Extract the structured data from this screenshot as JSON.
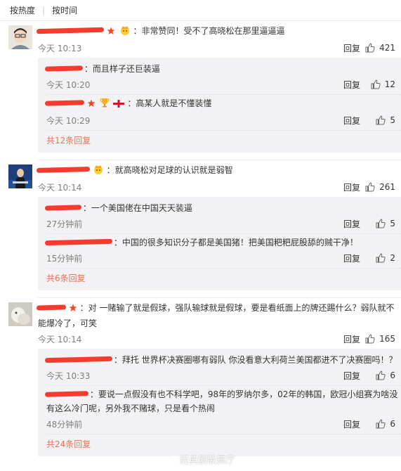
{
  "sort_bar": {
    "hot": "按热度",
    "time": "按时间"
  },
  "comments": [
    {
      "text": "：非常赞同！受不了高晓松在那里逼逼逼",
      "time": "今天 10:13",
      "reply": "回复",
      "likes": "421",
      "subs": [
        {
          "text": "：而且样子还巨装逼",
          "time": "今天 10:20",
          "reply": "回复",
          "likes": "12"
        },
        {
          "text": "：高某人就是不懂装懂",
          "time": "今天 10:29",
          "reply": "回复",
          "likes": "5"
        }
      ],
      "more": "共12条回复"
    },
    {
      "text": "：就高晓松对足球的认识就是弱智",
      "time": "今天 10:14",
      "reply": "回复",
      "likes": "261",
      "subs": [
        {
          "text": "：一个美国佬在中国天天装逼",
          "time": "27分钟前",
          "reply": "回复",
          "likes": "5"
        },
        {
          "text": "：中国的很多知识分子都是美国猪！把美国粑粑屁股舔的贼干净！",
          "time": "15分钟前",
          "reply": "回复",
          "likes": "2"
        }
      ],
      "more": "共6条回复"
    },
    {
      "text": "：对 一赌输了就是假球，强队输球就是假球，要是看纸面上的牌还踢什么？弱队就不能爆冷了，可笑",
      "time": "今天 10:14",
      "reply": "回复",
      "likes": "165",
      "subs": [
        {
          "text": "：拜托 世界杯决赛圈哪有弱队 你没看意大利荷兰美国都进不了决赛圈吗！？",
          "time": "今天 10:33",
          "reply": "回复",
          "likes": "6"
        },
        {
          "text": "：要说一点假没有也不科学吧，98年的罗纳尔多，02年的韩国，欧冠小组赛为啥没有这么冷门呢，另外我不赌球，只是看个热闹",
          "time": "48分钟前",
          "reply": "回复",
          "likes": "6"
        }
      ],
      "more": "共24条回复"
    }
  ],
  "watermark": "经典剧歌舞厅",
  "colors": {
    "name": "#eb7350",
    "scribble": "#f33c2e",
    "subbox": "#f2f2f5",
    "time": "#808080"
  },
  "icons": [
    "thumbs-up-icon",
    "star-icon",
    "crown-badge-icon",
    "trophy-icon",
    "england-flag-icon",
    "weibo-logo-icon"
  ]
}
